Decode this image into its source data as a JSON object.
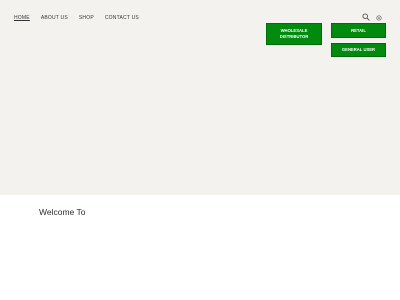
{
  "nav": {
    "items": [
      {
        "label": "HOME",
        "active": true
      },
      {
        "label": "ABOUT US",
        "active": false
      },
      {
        "label": "SHOP",
        "active": false
      },
      {
        "label": "CONTACT US",
        "active": false
      }
    ]
  },
  "header_icons": {
    "search": "search-icon",
    "settings": "gear-icon"
  },
  "buttons": {
    "wholesale_line1": "WHOLESALE",
    "wholesale_line2": "DISTRIBUTOR",
    "retail": "RETAIL",
    "general": "GENERAL USER"
  },
  "main": {
    "welcome": "Welcome To"
  },
  "colors": {
    "hero_bg": "#f3f2ee",
    "button_green": "#008a0e",
    "text_dark": "#333333"
  }
}
